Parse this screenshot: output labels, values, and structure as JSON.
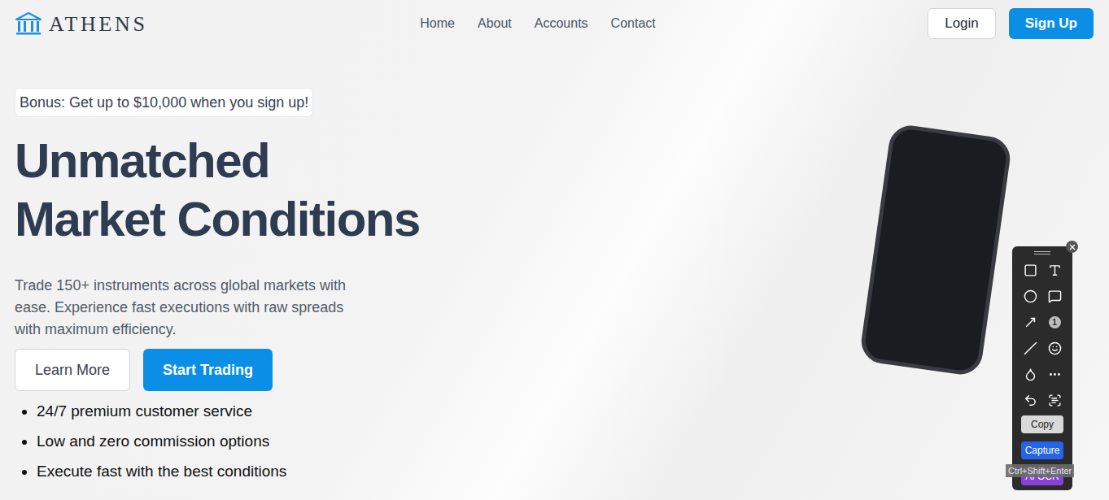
{
  "logo": {
    "name": "ATHENS"
  },
  "nav": {
    "links": [
      "Home",
      "About",
      "Accounts",
      "Contact"
    ]
  },
  "auth": {
    "login": "Login",
    "signup": "Sign Up"
  },
  "hero": {
    "badge": "Bonus: Get up to $10,000 when you sign up!",
    "title_lines": [
      "Unmatched",
      "Market Conditions"
    ],
    "description": "Trade 150+ instruments across global markets with ease. Experience fast executions with raw spreads with maximum efficiency.",
    "buttons": {
      "secondary": "Learn More",
      "primary": "Start Trading"
    },
    "features": [
      "24/7 premium customer service",
      "Low and zero commission options",
      "Execute fast with the best conditions"
    ]
  },
  "capture_toolbar": {
    "number_marker": "1",
    "actions": [
      {
        "label": "Copy",
        "kind": "neutral",
        "color": "#d9d9d9"
      },
      {
        "label": "Capture",
        "kind": "primary",
        "color": "#2563eb"
      },
      {
        "label": "AI OCR",
        "kind": "accent",
        "color": "#8b3fd9"
      }
    ],
    "shortcut_tooltip": "Ctrl+Shift+Enter"
  }
}
